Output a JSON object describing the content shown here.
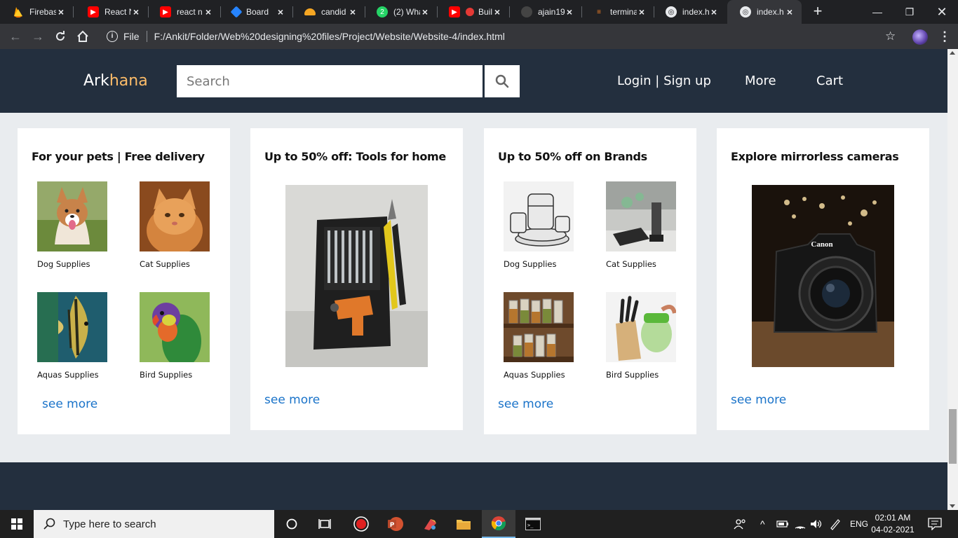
{
  "browser": {
    "tabs": [
      {
        "title": "Firebase",
        "icon": "firebase-icon"
      },
      {
        "title": "React N",
        "icon": "youtube-icon"
      },
      {
        "title": "react n",
        "icon": "youtube-icon"
      },
      {
        "title": "Board",
        "icon": "jira-icon"
      },
      {
        "title": "candid",
        "icon": "taco-icon"
      },
      {
        "title": "(2) Wha",
        "icon": "whatsapp-icon"
      },
      {
        "title": "Buil",
        "icon": "youtube-icon"
      },
      {
        "title": "ajain19",
        "icon": "github-icon"
      },
      {
        "title": "termina",
        "icon": "stackoverflow-icon"
      },
      {
        "title": "index.h",
        "icon": "globe-icon"
      },
      {
        "title": "index.h",
        "icon": "globe-icon"
      }
    ],
    "active_tab_index": 10,
    "address": {
      "scheme_label": "File",
      "url": "F:/Ankit/Folder/Web%20designing%20files/Project/Website/Website-4/index.html"
    }
  },
  "site": {
    "logo": {
      "part1": "Ark",
      "part2": "hana"
    },
    "search_placeholder": "Search",
    "nav": {
      "login": "Login | Sign up",
      "more": "More",
      "cart": "Cart"
    },
    "colors": {
      "header_bg": "#232f3e",
      "logo_accent": "#febd69",
      "link": "#1a73c9"
    }
  },
  "cards": [
    {
      "title": "For your pets | Free delivery",
      "items": [
        {
          "label": "Dog Supplies"
        },
        {
          "label": "Cat Supplies"
        },
        {
          "label": "Aquas Supplies"
        },
        {
          "label": "Bird Supplies"
        }
      ],
      "link": "see more"
    },
    {
      "title": "Up to 50% off: Tools for home",
      "link": "see more"
    },
    {
      "title": "Up to 50% off on Brands",
      "items": [
        {
          "label": "Dog Supplies"
        },
        {
          "label": "Cat Supplies"
        },
        {
          "label": "Aquas Supplies"
        },
        {
          "label": "Bird Supplies"
        }
      ],
      "link": "see more"
    },
    {
      "title": "Explore mirrorless cameras",
      "camera_brand": "Canon",
      "link": "see more"
    }
  ],
  "taskbar": {
    "search_placeholder": "Type here to search",
    "tray_language": "ENG",
    "time": "02:01 AM",
    "date": "04-02-2021"
  }
}
